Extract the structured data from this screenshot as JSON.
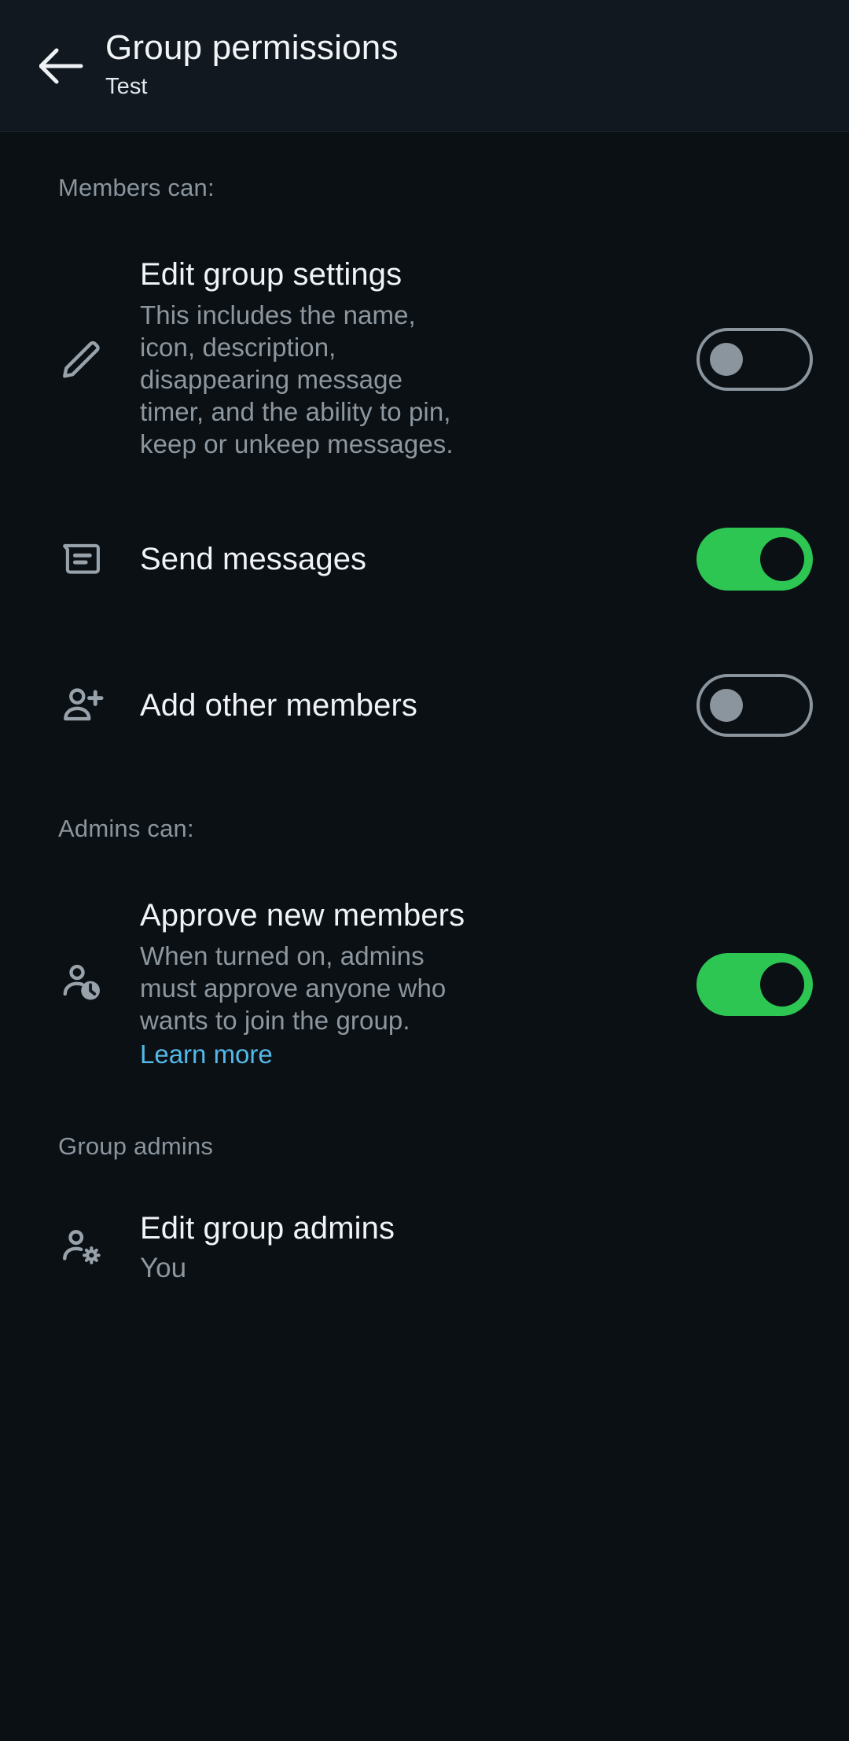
{
  "appbar": {
    "back_icon": "arrow-left-icon",
    "title": "Group permissions",
    "subtitle": "Test"
  },
  "sections": {
    "members": {
      "header": "Members can:",
      "items": [
        {
          "icon": "pencil-icon",
          "title": "Edit group settings",
          "description": "This includes the name, icon, description, disappearing message timer, and the ability to pin, keep or unkeep messages.",
          "toggle": "off"
        },
        {
          "icon": "message-icon",
          "title": "Send messages",
          "toggle": "on"
        },
        {
          "icon": "person-add-icon",
          "title": "Add other members",
          "toggle": "off"
        }
      ]
    },
    "admins": {
      "header": "Admins can:",
      "items": [
        {
          "icon": "person-clock-icon",
          "title": "Approve new members",
          "description": "When turned on, admins must approve anyone who wants to join the group.",
          "link_label": "Learn more",
          "toggle": "on"
        }
      ]
    },
    "group_admins": {
      "header": "Group admins",
      "items": [
        {
          "icon": "person-gear-icon",
          "title": "Edit group admins",
          "subtitle": "You"
        }
      ]
    }
  },
  "colors": {
    "background": "#0b1014",
    "appbar": "#111820",
    "toggle_on": "#2dc653",
    "toggle_off": "#8b959d",
    "link": "#53b9e8",
    "primary_text": "#f1f4f7",
    "secondary_text": "#8d979f"
  }
}
